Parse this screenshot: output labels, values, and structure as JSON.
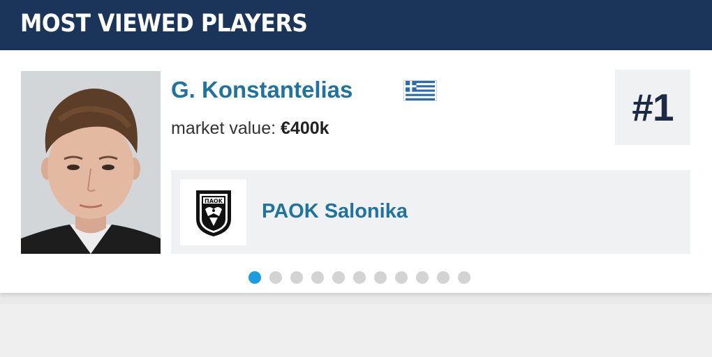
{
  "header": {
    "title": "MOST VIEWED PLAYERS"
  },
  "player": {
    "name": "G. Konstantelias",
    "nationality_icon": "greece-flag-icon",
    "market_label": "market value:",
    "market_value": "€400k",
    "rank": "#1",
    "photo_icon": "player-photo"
  },
  "club": {
    "name": "PAOK Salonika",
    "logo_text": "ΠΑΟΚ",
    "logo_icon": "paok-crest-icon"
  },
  "carousel": {
    "total": 11,
    "active_index": 0
  },
  "colors": {
    "header_bg": "#1b355a",
    "link_blue": "#1f73a1",
    "active_dot": "#1b9be0",
    "inactive_dot": "#d3d3d3"
  }
}
